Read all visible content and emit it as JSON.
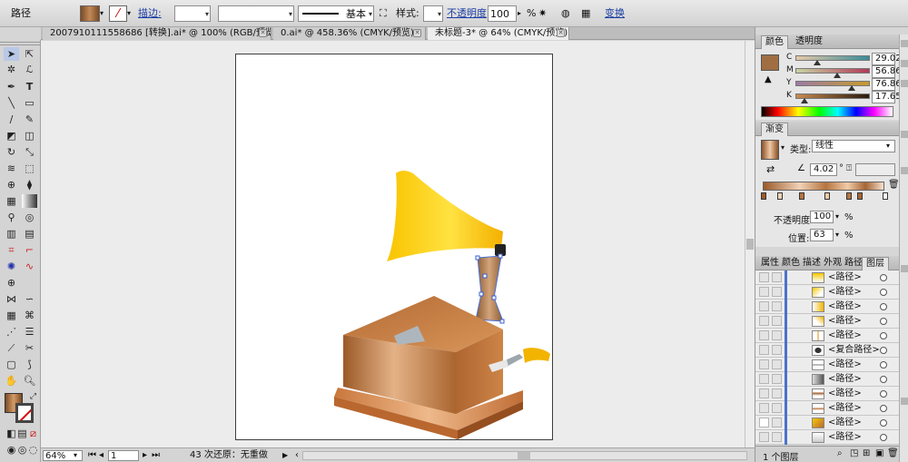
{
  "control_bar": {
    "object_type": "路径",
    "stroke_label": "描边:",
    "brush": "基本",
    "style_label": "样式:",
    "opacity_label": "不透明度",
    "opacity_value": "100",
    "opacity_unit": "%",
    "transform_label": "变换",
    "fill_color": "#a26e3f"
  },
  "tabs": [
    {
      "label": "2007910111558686 [转换].ai* @ 100% (RGB/预览)",
      "active": false
    },
    {
      "label": "0.ai* @ 458.36% (CMYK/预览)",
      "active": false
    },
    {
      "label": "未标题-3* @ 64% (CMYK/预览)",
      "active": true
    }
  ],
  "status_bar": {
    "zoom": "64%",
    "page": "1",
    "message": "43 次还原：无重做"
  },
  "color_panel": {
    "tabs": [
      "颜色",
      "透明度"
    ],
    "channels": [
      {
        "name": "C",
        "value": "29.02"
      },
      {
        "name": "M",
        "value": "56.86"
      },
      {
        "name": "Y",
        "value": "76.86"
      },
      {
        "name": "K",
        "value": "17.65"
      }
    ],
    "swatch": "#a06e42"
  },
  "gradient_panel": {
    "title": "渐变",
    "type_label": "类型:",
    "type_value": "线性",
    "angle_value": "4.02",
    "degree_symbol": "°",
    "opacity_label": "不透明度:",
    "opacity_value": "100",
    "location_label": "位置:",
    "location_value": "63",
    "percent": "%"
  },
  "layers_panel": {
    "tabs": [
      "属性",
      "颜色",
      "描述",
      "外观",
      "路径",
      "图层"
    ],
    "items": [
      {
        "name": "<路径>"
      },
      {
        "name": "<路径>"
      },
      {
        "name": "<路径>"
      },
      {
        "name": "<路径>"
      },
      {
        "name": "<路径>"
      },
      {
        "name": "<复合路径>"
      },
      {
        "name": "<路径>"
      },
      {
        "name": "<路径>"
      },
      {
        "name": "<路径>"
      },
      {
        "name": "<路径>"
      },
      {
        "name": "<路径>"
      },
      {
        "name": "<路径>"
      }
    ],
    "footer": "1 个图层"
  }
}
